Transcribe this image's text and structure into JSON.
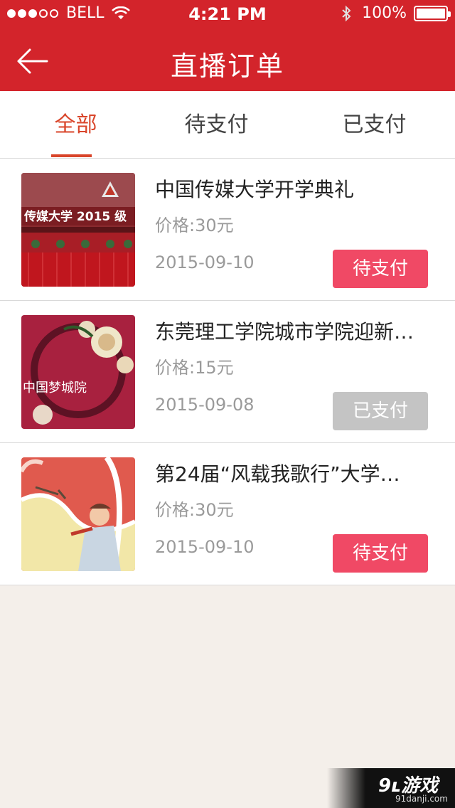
{
  "status_bar": {
    "carrier": "BELL",
    "time": "4:21 PM",
    "battery": "100%"
  },
  "header": {
    "title": "直播订单",
    "back_icon": "back-arrow-icon"
  },
  "tabs": [
    {
      "label": "全部",
      "active": true
    },
    {
      "label": "待支付",
      "active": false
    },
    {
      "label": "已支付",
      "active": false
    }
  ],
  "orders": [
    {
      "title": "中国传媒大学开学典礼",
      "price": "价格:30元",
      "date": "2015-09-10",
      "status": "待支付",
      "thumb_text": "传媒大学 2015 级"
    },
    {
      "title": "东莞理工学院城市学院迎新…",
      "price": "价格:15元",
      "date": "2015-09-08",
      "status": "已支付",
      "thumb_text": "中国梦城院"
    },
    {
      "title": "第24届“风载我歌行”大学…",
      "price": "价格:30元",
      "date": "2015-09-10",
      "status": "待支付"
    }
  ],
  "watermark": {
    "logo": "9ʟ游戏",
    "url": "91danji.com"
  },
  "colors": {
    "header": "#d3242b",
    "active_tab": "#d9452a",
    "unpaid_button": "#f04965",
    "paid_button": "#c4c4c4"
  }
}
